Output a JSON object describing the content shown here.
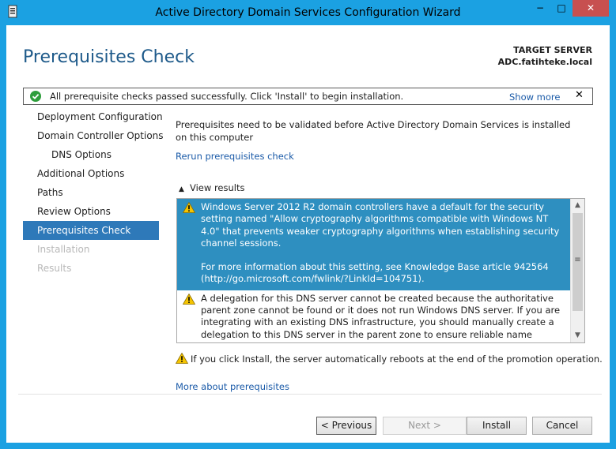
{
  "window": {
    "title": "Active Directory Domain Services Configuration Wizard",
    "minimize": "−",
    "maximize": "□",
    "close": "✕"
  },
  "header": {
    "page_title": "Prerequisites Check",
    "server_label": "TARGET SERVER",
    "server_name": "ADC.fatihteke.local"
  },
  "notification": {
    "message": "All prerequisite checks passed successfully.  Click 'Install' to begin installation.",
    "show_more": "Show more",
    "close": "✕"
  },
  "nav": {
    "items": [
      {
        "label": "Deployment Configuration"
      },
      {
        "label": "Domain Controller Options"
      },
      {
        "label": "DNS Options"
      },
      {
        "label": "Additional Options"
      },
      {
        "label": "Paths"
      },
      {
        "label": "Review Options"
      },
      {
        "label": "Prerequisites Check"
      },
      {
        "label": "Installation"
      },
      {
        "label": "Results"
      }
    ]
  },
  "main": {
    "intro": "Prerequisites need to be validated before Active Directory Domain Services is installed on this computer",
    "rerun_link": "Rerun prerequisites check",
    "view_results": "View results",
    "results": [
      {
        "text": "Windows Server 2012 R2 domain controllers have a default for the security setting named \"Allow cryptography algorithms compatible with Windows NT 4.0\" that prevents weaker cryptography algorithms when establishing security channel sessions.",
        "more": "For more information about this setting, see Knowledge Base article 942564 (http://go.microsoft.com/fwlink/?LinkId=104751)."
      },
      {
        "text": "A delegation for this DNS server cannot be created because the authoritative parent zone cannot be found or it does not run Windows DNS server. If you are integrating with an existing DNS infrastructure, you should manually create a delegation to this DNS server in the parent zone to ensure reliable name resolution from outside the domain \"fatihteke.local\". Otherwise, no action is required."
      }
    ],
    "reboot_warning": "If you click Install, the server automatically reboots at the end of the promotion operation.",
    "more_link": "More about prerequisites"
  },
  "buttons": {
    "previous": "< Previous",
    "next": "Next >",
    "install": "Install",
    "cancel": "Cancel"
  },
  "colors": {
    "accent": "#1ba1e2",
    "nav_selected": "#2e79b9",
    "result_selected": "#2e8fc0",
    "link": "#1a5aa8",
    "close_button": "#c75050"
  }
}
